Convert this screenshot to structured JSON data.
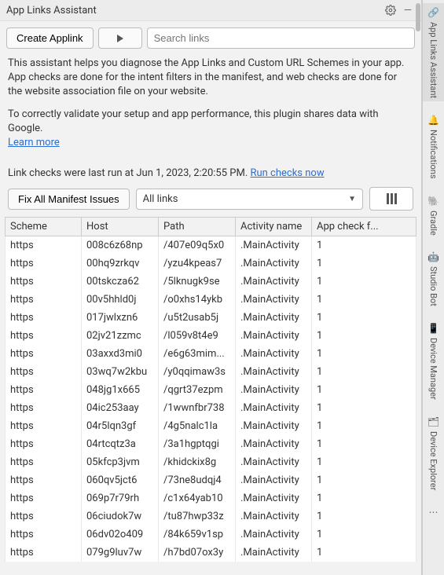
{
  "title": "App Links Assistant",
  "buttons": {
    "create": "Create Applink",
    "fix": "Fix All Manifest Issues"
  },
  "search": {
    "placeholder": "Search links"
  },
  "desc": {
    "p1": "This assistant helps you diagnose the App Links and Custom URL Schemes in your app. App checks are done for the intent filters in the manifest, and web checks are done for the website association file on your website.",
    "p2": "To correctly validate your setup and app performance, this plugin shares data with Google.",
    "learn": "Learn more"
  },
  "lastrun": {
    "prefix": "Link checks were last run at ",
    "ts": "Jun 1, 2023, 2:20:55 PM",
    "suffix": ". ",
    "action": "Run checks now"
  },
  "filter": {
    "selected": "All links"
  },
  "columns": [
    "Scheme",
    "Host",
    "Path",
    "Activity name",
    "App check f..."
  ],
  "rows": [
    {
      "scheme": "https",
      "host": "008c6z68np",
      "path": "/407e09q5x0",
      "activity": ".MainActivity",
      "flag": "1"
    },
    {
      "scheme": "https",
      "host": "00hq9zrkqv",
      "path": "/yzu4kpeas7",
      "activity": ".MainActivity",
      "flag": "1"
    },
    {
      "scheme": "https",
      "host": "00tskcza62",
      "path": "/5lknugk9se",
      "activity": ".MainActivity",
      "flag": "1"
    },
    {
      "scheme": "https",
      "host": "00v5hhld0j",
      "path": "/o0xhs14ykb",
      "activity": ".MainActivity",
      "flag": "1"
    },
    {
      "scheme": "https",
      "host": "017jwlxzn6",
      "path": "/u5t2usab5j",
      "activity": ".MainActivity",
      "flag": "1"
    },
    {
      "scheme": "https",
      "host": "02jv21zzmc",
      "path": "/l059v8t4e9",
      "activity": ".MainActivity",
      "flag": "1"
    },
    {
      "scheme": "https",
      "host": "03axxd3mi0",
      "path": "/e6g63mim...",
      "activity": ".MainActivity",
      "flag": "1"
    },
    {
      "scheme": "https",
      "host": "03wq7w2kbu",
      "path": "/y0qqimaw3s",
      "activity": ".MainActivity",
      "flag": "1"
    },
    {
      "scheme": "https",
      "host": "048jg1x665",
      "path": "/qgrt37ezpm",
      "activity": ".MainActivity",
      "flag": "1"
    },
    {
      "scheme": "https",
      "host": "04ic253aay",
      "path": "/1wwnfbr738",
      "activity": ".MainActivity",
      "flag": "1"
    },
    {
      "scheme": "https",
      "host": "04r5lqn3gf",
      "path": "/4g5nalc1la",
      "activity": ".MainActivity",
      "flag": "1"
    },
    {
      "scheme": "https",
      "host": "04rtcqtz3a",
      "path": "/3a1hgptqgi",
      "activity": ".MainActivity",
      "flag": "1"
    },
    {
      "scheme": "https",
      "host": "05kfcp3jvm",
      "path": "/khidckix8g",
      "activity": ".MainActivity",
      "flag": "1"
    },
    {
      "scheme": "https",
      "host": "060qv5jct6",
      "path": "/73ne8udqj4",
      "activity": ".MainActivity",
      "flag": "1"
    },
    {
      "scheme": "https",
      "host": "069p7r79rh",
      "path": "/c1x64yab10",
      "activity": ".MainActivity",
      "flag": "1"
    },
    {
      "scheme": "https",
      "host": "06ciudok7w",
      "path": "/tu87hwp33z",
      "activity": ".MainActivity",
      "flag": "1"
    },
    {
      "scheme": "https",
      "host": "06dv02o409",
      "path": "/84k659v1sp",
      "activity": ".MainActivity",
      "flag": "1"
    },
    {
      "scheme": "https",
      "host": "079g9luv7w",
      "path": "/h7bd07ox3y",
      "activity": ".MainActivity",
      "flag": "1"
    }
  ],
  "sidebar": [
    {
      "icon": "link",
      "label": "App Links Assistant",
      "active": true
    },
    {
      "icon": "bell",
      "label": "Notifications",
      "active": false
    },
    {
      "icon": "gradle",
      "label": "Gradle",
      "active": false
    },
    {
      "icon": "bot",
      "label": "Studio Bot",
      "active": false
    },
    {
      "icon": "device",
      "label": "Device Manager",
      "active": false
    },
    {
      "icon": "phone",
      "label": "Device Explorer",
      "active": false
    },
    {
      "icon": "more",
      "label": "",
      "active": false
    }
  ]
}
